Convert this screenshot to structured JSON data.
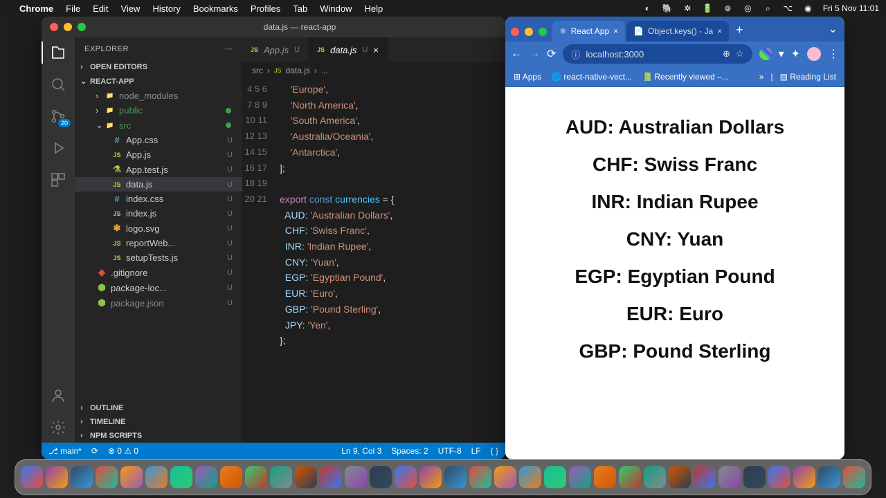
{
  "menubar": {
    "app": "Chrome",
    "items": [
      "File",
      "Edit",
      "View",
      "History",
      "Bookmarks",
      "Profiles",
      "Tab",
      "Window",
      "Help"
    ],
    "clock": "Fri 5 Nov  11:01"
  },
  "vscode": {
    "title": "data.js — react-app",
    "explorer": "EXPLORER",
    "badge": "20",
    "sections": {
      "openEditors": "OPEN EDITORS",
      "project": "REACT-APP",
      "outline": "OUTLINE",
      "timeline": "TIMELINE",
      "npm": "NPM SCRIPTS"
    },
    "tree": [
      {
        "name": "node_modules",
        "icon": "📁",
        "ind": 30,
        "chev": "›",
        "dim": true
      },
      {
        "name": "public",
        "icon": "📁",
        "ind": 30,
        "chev": "›",
        "dot": true,
        "color": "#3c9e4e"
      },
      {
        "name": "src",
        "icon": "📁",
        "ind": 30,
        "chev": "⌄",
        "dot": true,
        "color": "#3c9e4e"
      },
      {
        "name": "App.css",
        "icon": "#",
        "ind": 52,
        "mod": "U",
        "ic": "#519aba"
      },
      {
        "name": "App.js",
        "icon": "JS",
        "ind": 52,
        "mod": "U",
        "ic": "#cbcb41"
      },
      {
        "name": "App.test.js",
        "icon": "⚗",
        "ind": 52,
        "mod": "U",
        "ic": "#cbcb41"
      },
      {
        "name": "data.js",
        "icon": "JS",
        "ind": 52,
        "mod": "U",
        "ic": "#cbcb41",
        "sel": true
      },
      {
        "name": "index.css",
        "icon": "#",
        "ind": 52,
        "mod": "U",
        "ic": "#519aba"
      },
      {
        "name": "index.js",
        "icon": "JS",
        "ind": 52,
        "mod": "U",
        "ic": "#cbcb41"
      },
      {
        "name": "logo.svg",
        "icon": "✻",
        "ind": 52,
        "mod": "U",
        "ic": "#ffb13b"
      },
      {
        "name": "reportWeb...",
        "icon": "JS",
        "ind": 52,
        "mod": "U",
        "ic": "#cbcb41"
      },
      {
        "name": "setupTests.js",
        "icon": "JS",
        "ind": 52,
        "mod": "U",
        "ic": "#cbcb41"
      },
      {
        "name": ".gitignore",
        "icon": "◈",
        "ind": 30,
        "mod": "U",
        "ic": "#e8543f"
      },
      {
        "name": "package-loc...",
        "icon": "⬢",
        "ind": 30,
        "mod": "U",
        "ic": "#8bc34a"
      },
      {
        "name": "package.json",
        "icon": "⬢",
        "ind": 30,
        "mod": "U",
        "ic": "#8bc34a",
        "dim": true
      }
    ],
    "tabs": [
      {
        "name": "App.js",
        "mod": "U"
      },
      {
        "name": "data.js",
        "mod": "U",
        "active": true
      }
    ],
    "crumbs": [
      "src",
      "data.js",
      "..."
    ],
    "code": {
      "start": 4,
      "lines": [
        {
          "t": "    'Europe',",
          "ty": "s"
        },
        {
          "t": "    'North America',",
          "ty": "s"
        },
        {
          "t": "    'South America',",
          "ty": "s"
        },
        {
          "t": "    'Australia/Oceania',",
          "ty": "s"
        },
        {
          "t": "    'Antarctica',",
          "ty": "s"
        },
        {
          "t": "];",
          "ty": "d"
        },
        {
          "t": "",
          "ty": "d"
        },
        {
          "t": "export const currencies = {",
          "ty": "dec"
        },
        {
          "t": "  AUD: 'Australian Dollars',",
          "ty": "kv"
        },
        {
          "t": "  CHF: 'Swiss Franc',",
          "ty": "kv"
        },
        {
          "t": "  INR: 'Indian Rupee',",
          "ty": "kv"
        },
        {
          "t": "  CNY: 'Yuan',",
          "ty": "kv"
        },
        {
          "t": "  EGP: 'Egyptian Pound',",
          "ty": "kv"
        },
        {
          "t": "  EUR: 'Euro',",
          "ty": "kv"
        },
        {
          "t": "  GBP: 'Pound Sterling',",
          "ty": "kv"
        },
        {
          "t": "  JPY: 'Yen',",
          "ty": "kv"
        },
        {
          "t": "};",
          "ty": "d"
        },
        {
          "t": "",
          "ty": "d"
        }
      ]
    },
    "status": {
      "branch": "main*",
      "sync": "⟳",
      "errors": "⊗ 0 ⚠ 0",
      "pos": "Ln 9, Col 3",
      "spaces": "Spaces: 2",
      "enc": "UTF-8",
      "eol": "LF",
      "lang": "{ }"
    }
  },
  "chrome": {
    "tabs": [
      {
        "label": "React App",
        "icon": "⚛",
        "active": true
      },
      {
        "label": "Object.keys() - Ja",
        "icon": "📄"
      }
    ],
    "url": "localhost:3000",
    "bookmarks": [
      "Apps",
      "react-native-vect...",
      "Recently viewed –..."
    ],
    "reading": "Reading List",
    "page": [
      "AUD: Australian Dollars",
      "CHF: Swiss Franc",
      "INR: Indian Rupee",
      "CNY: Yuan",
      "EGP: Egyptian Pound",
      "EUR: Euro",
      "GBP: Pound Sterling"
    ]
  },
  "dock_count": 34
}
